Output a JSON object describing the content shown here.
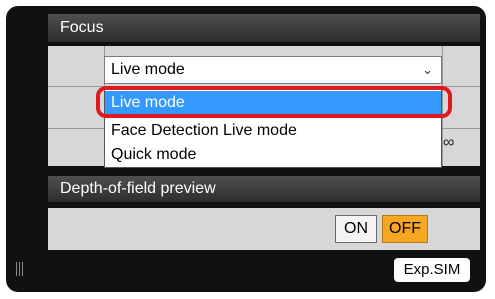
{
  "focus": {
    "header": "Focus",
    "mode_select": {
      "value": "Live mode",
      "arrow_icon": "chevron-down-icon"
    },
    "dropdown_options": [
      "Live mode",
      "Face Detection Live mode",
      "Quick mode"
    ],
    "selected_index": 0,
    "infinity_symbol": "∞"
  },
  "depth_of_field": {
    "header": "Depth-of-field preview",
    "on_label": "ON",
    "off_label": "OFF",
    "active": "OFF",
    "active_color": "#f5a623"
  },
  "footer": {
    "exp_sim_label": "Exp.SIM"
  },
  "colors": {
    "selection": "#3399ff",
    "highlight_ring": "#e0191e"
  }
}
